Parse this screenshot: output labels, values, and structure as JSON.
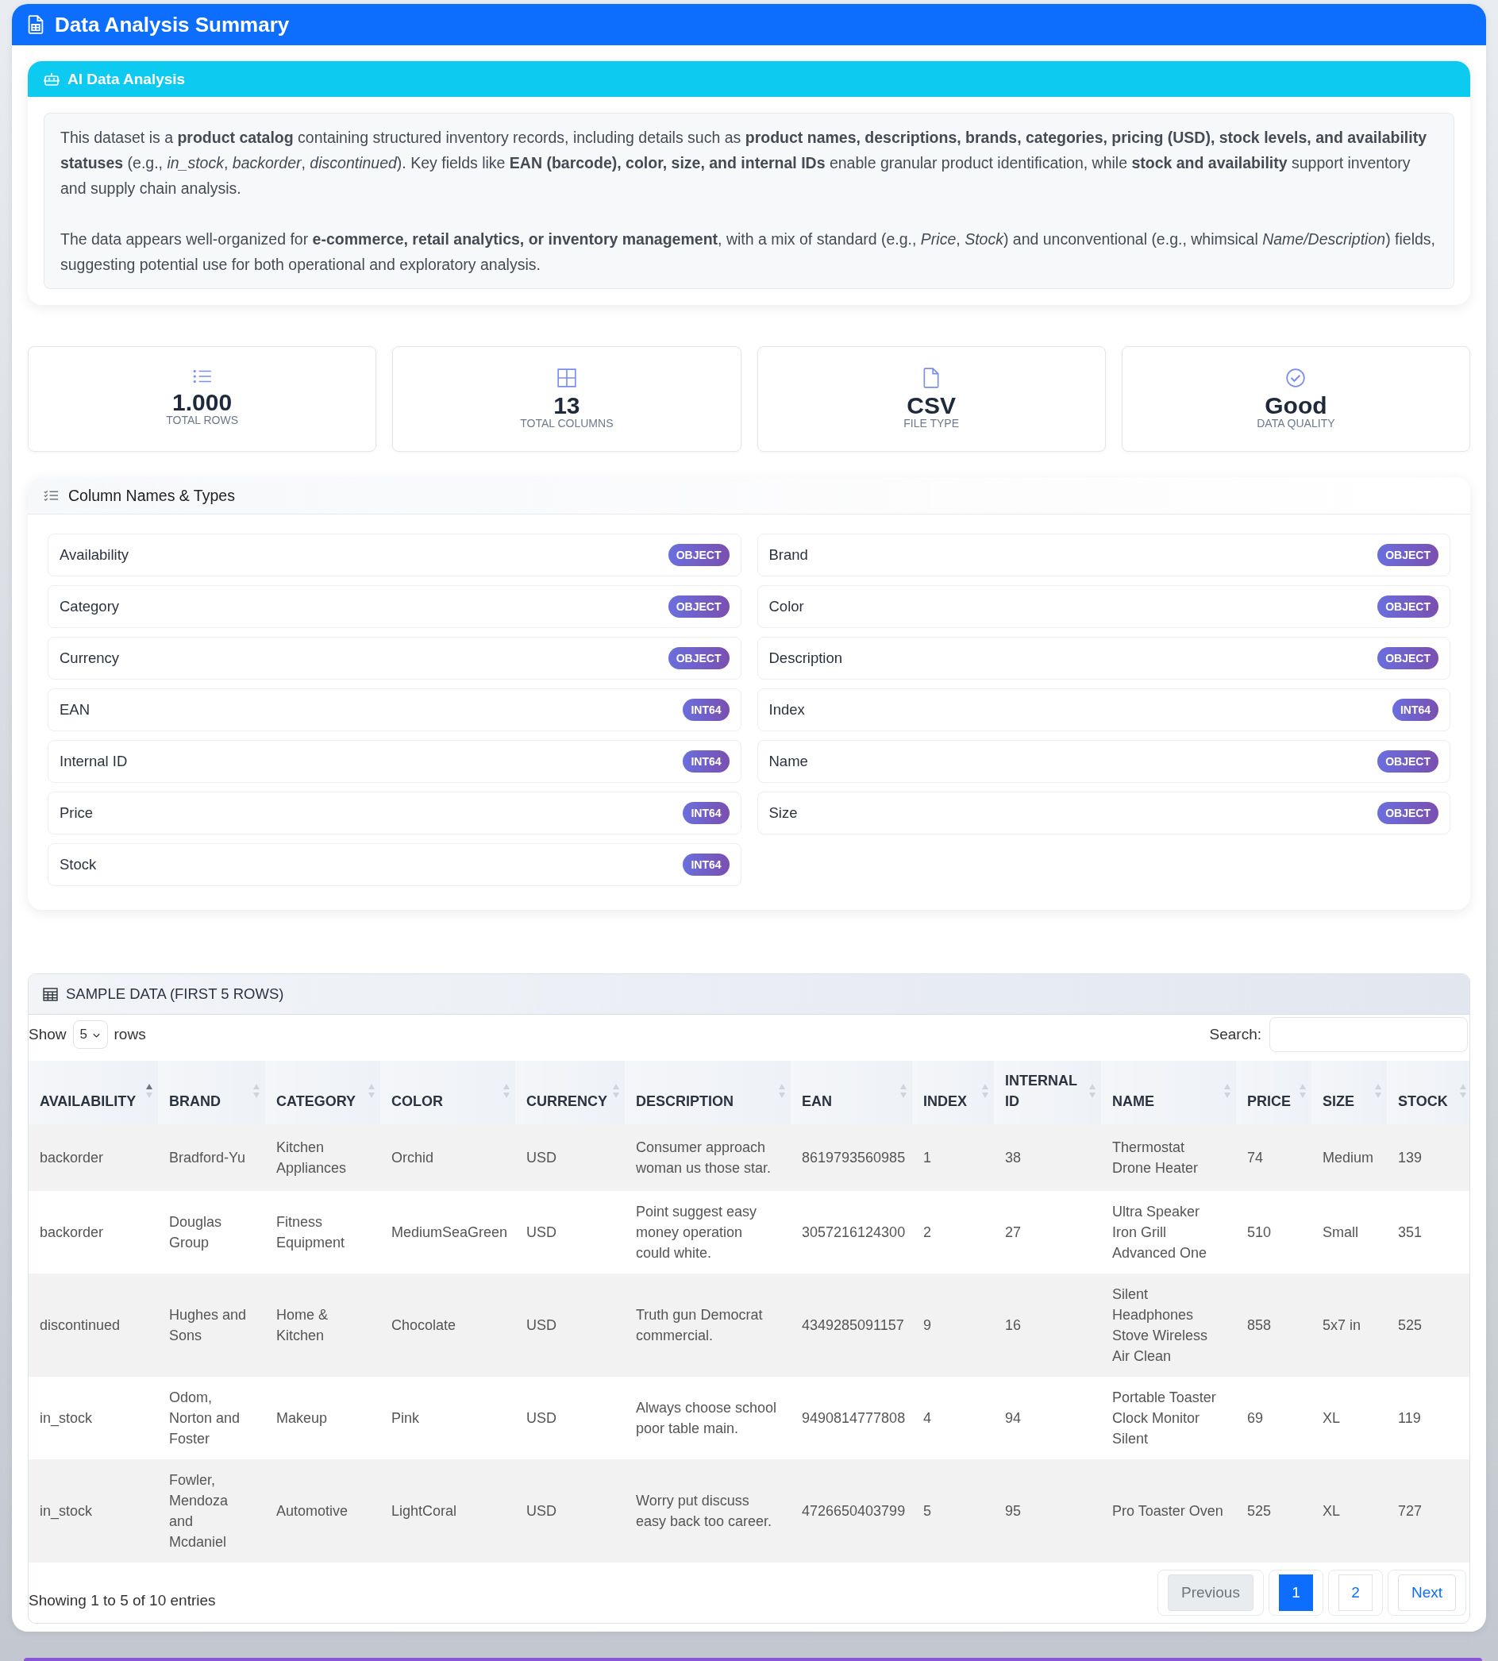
{
  "header": {
    "title": "Data Analysis Summary"
  },
  "ai_analysis": {
    "title": "AI Data Analysis",
    "paragraphs": [
      "This dataset is a **product catalog** containing structured inventory records, including details such as **product names, descriptions, brands, categories, pricing (USD), stock levels, and availability statuses** (e.g., *in_stock*, *backorder*, *discontinued*). Key fields like **EAN (barcode), color, size, and internal IDs** enable granular product identification, while **stock and availability** support inventory and supply chain analysis.",
      "The data appears well-organized for **e-commerce, retail analytics, or inventory management**, with a mix of standard (e.g., *Price*, *Stock*) and unconventional (e.g., whimsical *Name/Description*) fields, suggesting potential use for both operational and exploratory analysis."
    ]
  },
  "stats": [
    {
      "kind": "rows",
      "value": "1.000",
      "label": "TOTAL ROWS"
    },
    {
      "kind": "columns",
      "value": "13",
      "label": "TOTAL COLUMNS"
    },
    {
      "kind": "file",
      "value": "CSV",
      "label": "FILE TYPE"
    },
    {
      "kind": "quality",
      "value": "Good",
      "label": "DATA QUALITY"
    }
  ],
  "column_types": {
    "title": "Column Names & Types",
    "items": [
      {
        "name": "Availability",
        "type": "OBJECT"
      },
      {
        "name": "Brand",
        "type": "OBJECT"
      },
      {
        "name": "Category",
        "type": "OBJECT"
      },
      {
        "name": "Color",
        "type": "OBJECT"
      },
      {
        "name": "Currency",
        "type": "OBJECT"
      },
      {
        "name": "Description",
        "type": "OBJECT"
      },
      {
        "name": "EAN",
        "type": "INT64"
      },
      {
        "name": "Index",
        "type": "INT64"
      },
      {
        "name": "Internal ID",
        "type": "INT64"
      },
      {
        "name": "Name",
        "type": "OBJECT"
      },
      {
        "name": "Price",
        "type": "INT64"
      },
      {
        "name": "Size",
        "type": "OBJECT"
      },
      {
        "name": "Stock",
        "type": "INT64"
      }
    ]
  },
  "sample_data": {
    "title": "SAMPLE DATA (FIRST 5 ROWS)",
    "show_label": "Show",
    "show_value": "5",
    "rows_label": "rows",
    "search_label": "Search:",
    "columns": [
      {
        "label": "AVAILABILITY",
        "sorted": true
      },
      {
        "label": "BRAND",
        "sorted": false
      },
      {
        "label": "CATEGORY",
        "sorted": false
      },
      {
        "label": "COLOR",
        "sorted": false
      },
      {
        "label": "CURRENCY",
        "sorted": false
      },
      {
        "label": "DESCRIPTION",
        "sorted": false
      },
      {
        "label": "EAN",
        "sorted": false
      },
      {
        "label": "INDEX",
        "sorted": false
      },
      {
        "label": "INTERNAL ID",
        "sorted": false
      },
      {
        "label": "NAME",
        "sorted": false
      },
      {
        "label": "PRICE",
        "sorted": false
      },
      {
        "label": "SIZE",
        "sorted": false
      },
      {
        "label": "STOCK",
        "sorted": false
      }
    ],
    "rows": [
      [
        "backorder",
        "Bradford-Yu",
        "Kitchen Appliances",
        "Orchid",
        "USD",
        "Consumer approach woman us those star.",
        "8619793560985",
        "1",
        "38",
        "Thermostat Drone Heater",
        "74",
        "Medium",
        "139"
      ],
      [
        "backorder",
        "Douglas Group",
        "Fitness Equipment",
        "MediumSeaGreen",
        "USD",
        "Point suggest easy money operation could white.",
        "3057216124300",
        "2",
        "27",
        "Ultra Speaker Iron Grill Advanced One",
        "510",
        "Small",
        "351"
      ],
      [
        "discontinued",
        "Hughes and Sons",
        "Home & Kitchen",
        "Chocolate",
        "USD",
        "Truth gun Democrat commercial.",
        "4349285091157",
        "9",
        "16",
        "Silent Headphones Stove Wireless Air Clean",
        "858",
        "5x7 in",
        "525"
      ],
      [
        "in_stock",
        "Odom, Norton and Foster",
        "Makeup",
        "Pink",
        "USD",
        "Always choose school poor table main.",
        "9490814777808",
        "4",
        "94",
        "Portable Toaster Clock Monitor Silent",
        "69",
        "XL",
        "119"
      ],
      [
        "in_stock",
        "Fowler, Mendoza and Mcdaniel",
        "Automotive",
        "LightCoral",
        "USD",
        "Worry put discuss easy back too career.",
        "4726650403799",
        "5",
        "95",
        "Pro Toaster Oven",
        "525",
        "XL",
        "727"
      ]
    ],
    "info": "Showing 1 to 5 of 10 entries",
    "pagination": [
      {
        "label": "Previous",
        "kind": "prev",
        "disabled": true,
        "selected": false
      },
      {
        "label": "1",
        "kind": "page",
        "disabled": false,
        "selected": true
      },
      {
        "label": "2",
        "kind": "page",
        "disabled": false,
        "selected": false
      },
      {
        "label": "Next",
        "kind": "next",
        "disabled": false,
        "selected": false
      }
    ]
  }
}
